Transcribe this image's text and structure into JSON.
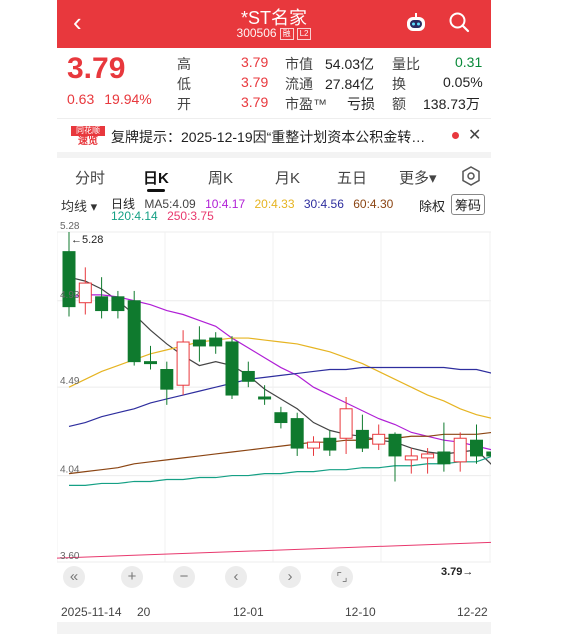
{
  "header": {
    "title": "*ST名家",
    "code": "300506",
    "tag1": "融",
    "tag2": "L2"
  },
  "quote": {
    "price": "3.79",
    "change": "0.63",
    "change_pct": "19.94%",
    "rows": [
      {
        "l1": "高",
        "v1": "3.79",
        "l2": "市值",
        "v2": "54.03亿",
        "l3": "量比",
        "v3": "0.31"
      },
      {
        "l1": "低",
        "v1": "3.79",
        "l2": "流通",
        "v2": "27.84亿",
        "l3": "换",
        "v3": "0.05%"
      },
      {
        "l1": "开",
        "v1": "3.79",
        "l2": "市盈™",
        "v2": "亏损",
        "l3": "额",
        "v3": "138.73万"
      }
    ]
  },
  "notice": {
    "logo_top": "同花顺",
    "logo_bottom": "速览",
    "text": "复牌提示：2025-12-19因“重整计划资本公积金转…"
  },
  "tabs": [
    "分时",
    "日K",
    "周K",
    "月K",
    "五日",
    "更多▾"
  ],
  "ma": {
    "ctrl": "均线 ▾",
    "day": "日线",
    "items": [
      {
        "label": "MA5:4.09",
        "color": "#444444"
      },
      {
        "label": "10:4.17",
        "color": "#b01fd6"
      },
      {
        "label": "20:4.33",
        "color": "#e6b422"
      },
      {
        "label": "30:4.56",
        "color": "#2e2e9e"
      },
      {
        "label": "60:4.30",
        "color": "#8b4513"
      }
    ],
    "items2": [
      {
        "label": "120:4.14",
        "color": "#15a085"
      },
      {
        "label": "250:3.75",
        "color": "#e8386d"
      }
    ],
    "chuquan": "除权",
    "chouma": "筹码"
  },
  "chart_data": {
    "type": "candlestick",
    "price_axis_labels": [
      "5.28",
      "4.93",
      "4.49",
      "4.04",
      "3.60"
    ],
    "ylim": [
      3.6,
      5.28
    ],
    "max_label": "5.28",
    "last_label": "3.79",
    "x_labels": [
      "2025-11-14",
      "20",
      "12-01",
      "12-10",
      "12-22"
    ],
    "candles": [
      {
        "o": 5.18,
        "c": 4.9,
        "h": 5.28,
        "l": 4.85
      },
      {
        "o": 4.92,
        "c": 5.02,
        "h": 5.1,
        "l": 4.86
      },
      {
        "o": 4.95,
        "c": 4.88,
        "h": 5.05,
        "l": 4.84
      },
      {
        "o": 4.95,
        "c": 4.88,
        "h": 4.98,
        "l": 4.84
      },
      {
        "o": 4.93,
        "c": 4.62,
        "h": 4.98,
        "l": 4.6
      },
      {
        "o": 4.62,
        "c": 4.61,
        "h": 4.7,
        "l": 4.58
      },
      {
        "o": 4.58,
        "c": 4.48,
        "h": 4.62,
        "l": 4.4
      },
      {
        "o": 4.5,
        "c": 4.72,
        "h": 4.78,
        "l": 4.45
      },
      {
        "o": 4.73,
        "c": 4.7,
        "h": 4.8,
        "l": 4.62
      },
      {
        "o": 4.74,
        "c": 4.7,
        "h": 4.77,
        "l": 4.66
      },
      {
        "o": 4.72,
        "c": 4.45,
        "h": 4.75,
        "l": 4.43
      },
      {
        "o": 4.57,
        "c": 4.52,
        "h": 4.62,
        "l": 4.49
      },
      {
        "o": 4.44,
        "c": 4.43,
        "h": 4.5,
        "l": 4.4
      },
      {
        "o": 4.36,
        "c": 4.31,
        "h": 4.39,
        "l": 4.28
      },
      {
        "o": 4.33,
        "c": 4.18,
        "h": 4.36,
        "l": 4.14
      },
      {
        "o": 4.18,
        "c": 4.21,
        "h": 4.24,
        "l": 4.14
      },
      {
        "o": 4.23,
        "c": 4.17,
        "h": 4.27,
        "l": 4.14
      },
      {
        "o": 4.23,
        "c": 4.38,
        "h": 4.44,
        "l": 4.15
      },
      {
        "o": 4.27,
        "c": 4.18,
        "h": 4.35,
        "l": 4.16
      },
      {
        "o": 4.2,
        "c": 4.25,
        "h": 4.3,
        "l": 4.17
      },
      {
        "o": 4.25,
        "c": 4.14,
        "h": 4.26,
        "l": 4.01
      },
      {
        "o": 4.12,
        "c": 4.14,
        "h": 4.18,
        "l": 4.05
      },
      {
        "o": 4.13,
        "c": 4.15,
        "h": 4.18,
        "l": 4.05
      },
      {
        "o": 4.16,
        "c": 4.1,
        "h": 4.31,
        "l": 4.06
      },
      {
        "o": 4.11,
        "c": 4.23,
        "h": 4.26,
        "l": 4.06
      },
      {
        "o": 4.22,
        "c": 4.14,
        "h": 4.3,
        "l": 4.1
      },
      {
        "o": 4.16,
        "c": 4.14,
        "h": 4.21,
        "l": 4.1
      }
    ],
    "ma_series": {
      "ma5": [
        5.05,
        5.03,
        4.99,
        4.93,
        4.86,
        4.78,
        4.71,
        4.65,
        4.6,
        4.62,
        4.6,
        4.55,
        4.48,
        4.43,
        4.38,
        4.31,
        4.27,
        4.25,
        4.24,
        4.22,
        4.21,
        4.18,
        4.16,
        4.15,
        4.16,
        4.17,
        4.09
      ],
      "ma10": [
        4.95,
        4.96,
        4.96,
        4.95,
        4.93,
        4.91,
        4.88,
        4.86,
        4.83,
        4.8,
        4.74,
        4.69,
        4.64,
        4.59,
        4.55,
        4.49,
        4.45,
        4.41,
        4.37,
        4.33,
        4.3,
        4.26,
        4.24,
        4.22,
        4.21,
        4.19,
        4.17
      ],
      "ma20": [
        4.49,
        4.53,
        4.57,
        4.6,
        4.63,
        4.66,
        4.68,
        4.7,
        4.72,
        4.73,
        4.74,
        4.74,
        4.73,
        4.72,
        4.71,
        4.69,
        4.67,
        4.64,
        4.61,
        4.57,
        4.53,
        4.49,
        4.45,
        4.42,
        4.38,
        4.35,
        4.33
      ],
      "ma30": [
        4.29,
        4.31,
        4.34,
        4.36,
        4.38,
        4.41,
        4.43,
        4.45,
        4.47,
        4.49,
        4.51,
        4.53,
        4.54,
        4.55,
        4.56,
        4.57,
        4.58,
        4.58,
        4.59,
        4.59,
        4.59,
        4.59,
        4.59,
        4.59,
        4.58,
        4.58,
        4.56
      ],
      "ma60": [
        4.05,
        4.06,
        4.07,
        4.08,
        4.1,
        4.11,
        4.12,
        4.13,
        4.14,
        4.15,
        4.16,
        4.17,
        4.18,
        4.19,
        4.2,
        4.21,
        4.21,
        4.22,
        4.22,
        4.23,
        4.23,
        4.24,
        4.24,
        4.25,
        4.25,
        4.25,
        4.26
      ],
      "ma120": [
        3.99,
        3.99,
        4.0,
        4.0,
        4.01,
        4.01,
        4.02,
        4.02,
        4.03,
        4.03,
        4.04,
        4.04,
        4.05,
        4.05,
        4.06,
        4.06,
        4.07,
        4.07,
        4.08,
        4.08,
        4.09,
        4.09,
        4.1,
        4.1,
        4.11,
        4.11,
        4.14
      ]
    }
  },
  "colors": {
    "up": "#e8383d",
    "down": "#0f7a2e"
  }
}
